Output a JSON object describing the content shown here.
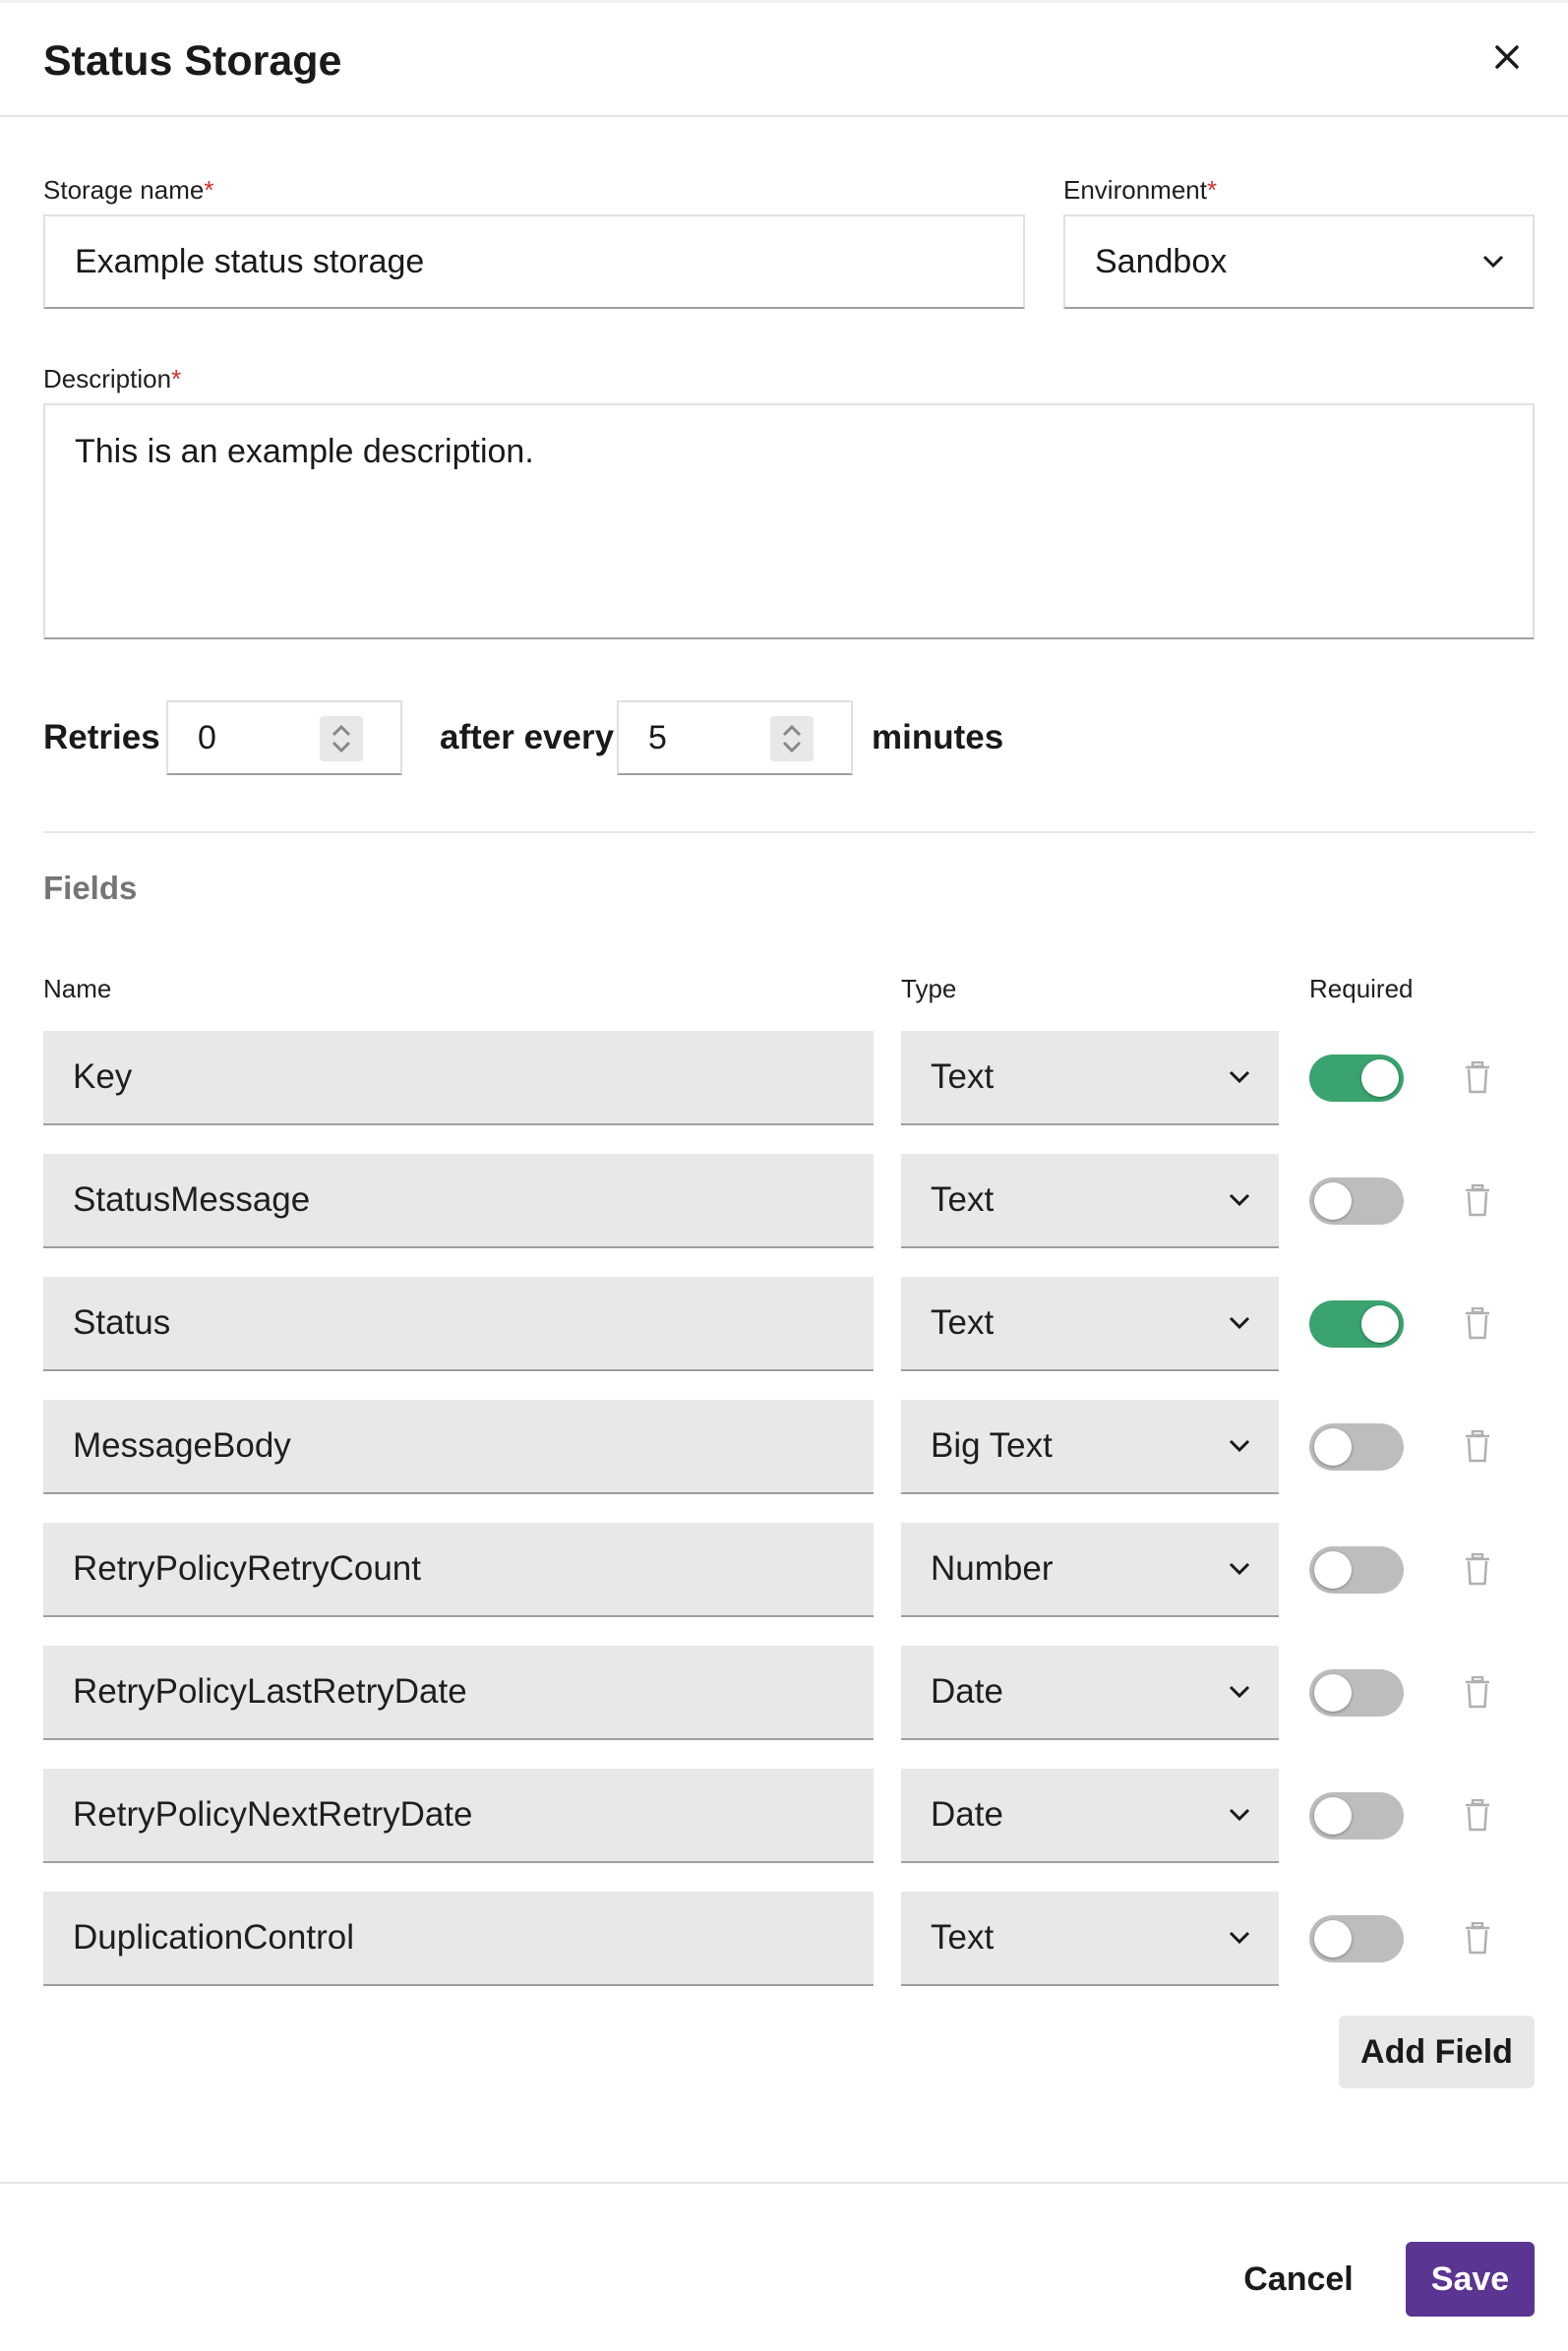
{
  "dialog": {
    "title": "Status Storage"
  },
  "form": {
    "storage_name_label": "Storage name",
    "storage_name_value": "Example status storage",
    "environment_label": "Environment",
    "environment_value": "Sandbox",
    "description_label": "Description",
    "description_value": "This is an example description.",
    "required_mark": "*"
  },
  "retries": {
    "label": "Retries",
    "count": "0",
    "after_label": "after every",
    "interval": "5",
    "unit_label": "minutes"
  },
  "fields": {
    "section_title": "Fields",
    "headers": {
      "name": "Name",
      "type": "Type",
      "required": "Required"
    },
    "rows": [
      {
        "name": "Key",
        "type": "Text",
        "required": true
      },
      {
        "name": "StatusMessage",
        "type": "Text",
        "required": false
      },
      {
        "name": "Status",
        "type": "Text",
        "required": true
      },
      {
        "name": "MessageBody",
        "type": "Big Text",
        "required": false
      },
      {
        "name": "RetryPolicyRetryCount",
        "type": "Number",
        "required": false
      },
      {
        "name": "RetryPolicyLastRetryDate",
        "type": "Date",
        "required": false
      },
      {
        "name": "RetryPolicyNextRetryDate",
        "type": "Date",
        "required": false
      },
      {
        "name": "DuplicationControl",
        "type": "Text",
        "required": false
      }
    ],
    "add_label": "Add Field"
  },
  "footer": {
    "cancel_label": "Cancel",
    "save_label": "Save"
  },
  "colors": {
    "toggle_on": "#3aa36f",
    "toggle_off": "#bdbdbd",
    "save_button": "#5a3592",
    "required_mark": "#d32f2f"
  },
  "icons": {
    "close": "close-icon",
    "chevron": "chevron-down-icon",
    "stepper": "stepper-icon",
    "delete": "trash-icon"
  }
}
